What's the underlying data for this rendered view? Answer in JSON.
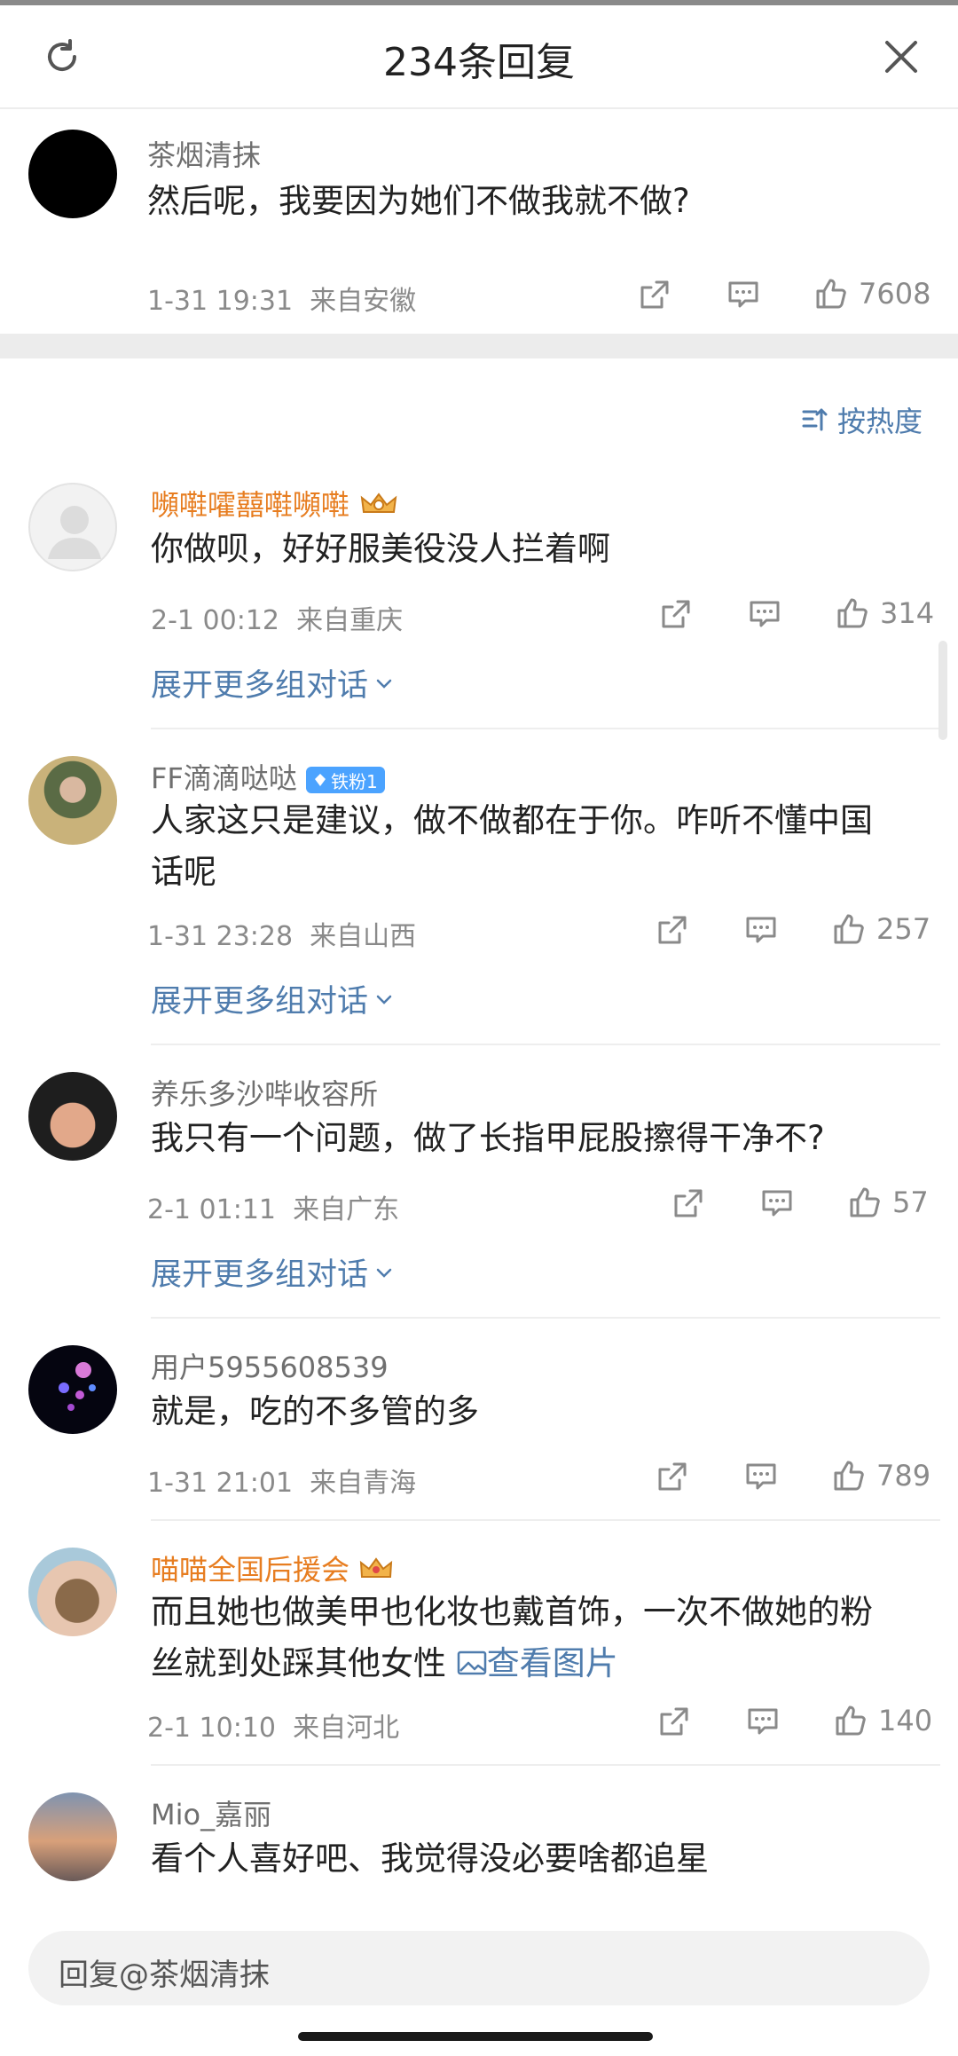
{
  "header": {
    "title": "234条回复"
  },
  "original_comment": {
    "username": "茶烟清抹",
    "text": "然后呢，我要因为她们不做我就不做?",
    "time": "1-31 19:31",
    "location": "来自安徽",
    "likes": "7608"
  },
  "sort": {
    "label": "按热度"
  },
  "replies": [
    {
      "username": "嚬嚡嚯囍嚡嚬嚡",
      "text": "你做呗，好好服美役没人拦着啊",
      "time": "2-1 00:12",
      "location": "来自重庆",
      "likes": "314",
      "expand": "展开更多组对话"
    },
    {
      "username": "FF滴滴哒哒",
      "badge": "铁粉1",
      "text_line1": "人家这只是建议，做不做都在于你。咋听不懂中国",
      "text_line2": "话呢",
      "time": "1-31 23:28",
      "location": "来自山西",
      "likes": "257",
      "expand": "展开更多组对话"
    },
    {
      "username": "养乐多沙哔收容所",
      "text": "我只有一个问题，做了长指甲屁股擦得干净不?",
      "time": "2-1 01:11",
      "location": "来自广东",
      "likes": "57",
      "expand": "展开更多组对话"
    },
    {
      "username": "用户5955608539",
      "text": "就是，吃的不多管的多",
      "time": "1-31 21:01",
      "location": "来自青海",
      "likes": "789"
    },
    {
      "username": "喵喵全国后援会",
      "text_line1": "而且她也做美甲也化妆也戴首饰，一次不做她的粉",
      "text_line2": "丝就到处踩其他女性",
      "image_link": "查看图片",
      "time": "2-1 10:10",
      "location": "来自河北",
      "likes": "140"
    },
    {
      "username": "Mio_嘉丽",
      "text": "看个人喜好吧、我觉得没必要啥都追星"
    }
  ],
  "reply_input": {
    "placeholder": "回复@茶烟清抹"
  },
  "colors": {
    "link": "#4f7cad",
    "vip_name": "#e77d20",
    "badge": "#4ba3ff"
  }
}
